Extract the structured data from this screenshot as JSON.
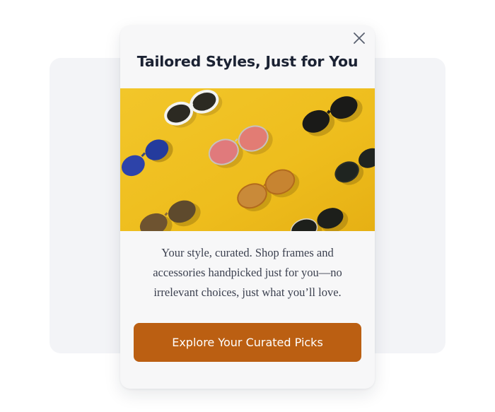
{
  "popup": {
    "title": "Tailored Styles, Just for You",
    "description": "Your style, curated. Shop frames and accessories handpicked just for you—no irrelevant choices, just what you’ll love.",
    "cta_label": "Explore Your Curated Picks",
    "close_icon": "close-icon",
    "hero_image": "sunglasses-on-yellow-image"
  },
  "colors": {
    "cta": "#bb5f12",
    "title": "#1b2233",
    "hero_background": "#f0c325"
  }
}
